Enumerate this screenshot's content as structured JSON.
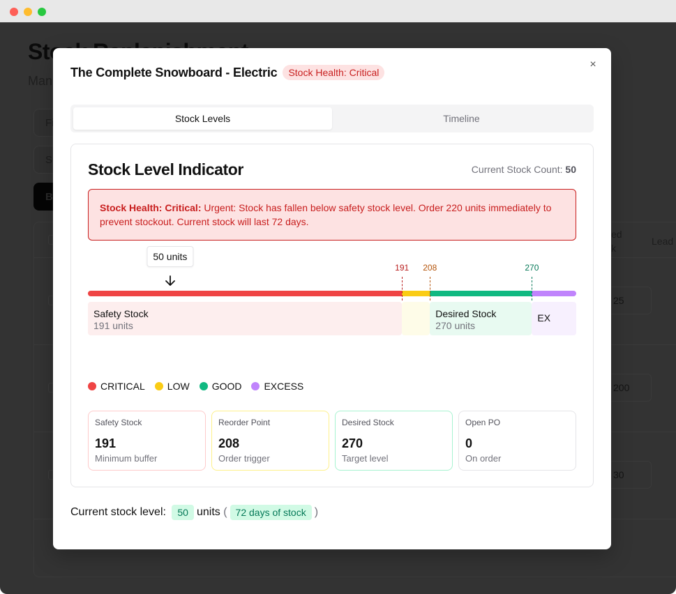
{
  "window": {
    "traffic_lights": [
      "close",
      "minimize",
      "maximize"
    ]
  },
  "background_page": {
    "title": "Stock Replenishment",
    "subtitle": "Man",
    "buttons": [
      "Fi",
      "Su",
      "Bu"
    ],
    "table_headers": [
      "ed\nk",
      "Lead"
    ],
    "lead_values": [
      "25",
      "200",
      "30"
    ]
  },
  "modal": {
    "title": "The Complete Snowboard - Electric",
    "health_badge": "Stock Health: Critical",
    "close_icon": "×",
    "tabs": [
      {
        "label": "Stock Levels",
        "active": true
      },
      {
        "label": "Timeline",
        "active": false
      }
    ],
    "card": {
      "title": "Stock Level Indicator",
      "stock_count_label": "Current Stock Count:",
      "stock_count_value": "50",
      "alert": {
        "prefix": "Stock Health: Critical:",
        "message": " Urgent: Stock has fallen below safety stock level. Order 220 units immediately to prevent stockout. Current stock will last 72 days."
      },
      "indicator": {
        "current_units": 50,
        "current_label": "50 units",
        "scale_max": 297,
        "thresholds": [
          {
            "value": 191,
            "label": "191",
            "color": "#b91c1c"
          },
          {
            "value": 208,
            "label": "208",
            "color": "#b45309"
          },
          {
            "value": 270,
            "label": "270",
            "color": "#047857"
          }
        ],
        "segments": [
          {
            "name": "critical",
            "from": 0,
            "to": 191,
            "color": "#ef4444"
          },
          {
            "name": "low",
            "from": 191,
            "to": 208,
            "color": "#facc15"
          },
          {
            "name": "good",
            "from": 208,
            "to": 270,
            "color": "#10b981"
          },
          {
            "name": "excess",
            "from": 270,
            "to": 297,
            "color": "#c084fc"
          }
        ],
        "zones": [
          {
            "name": "Safety Stock",
            "units": "191 units",
            "from": 0,
            "to": 191,
            "bg": "#fdeeee"
          },
          {
            "name": "",
            "units": "",
            "from": 191,
            "to": 208,
            "bg": "#fefce8"
          },
          {
            "name": "Desired Stock",
            "units": "270 units",
            "from": 208,
            "to": 270,
            "bg": "#e8faf1"
          },
          {
            "name": "EX",
            "units": "",
            "from": 270,
            "to": 297,
            "bg": "#f7f0fe"
          }
        ]
      },
      "legend": [
        {
          "label": "CRITICAL",
          "color": "#ef4444"
        },
        {
          "label": "LOW",
          "color": "#facc15"
        },
        {
          "label": "GOOD",
          "color": "#10b981"
        },
        {
          "label": "EXCESS",
          "color": "#c084fc"
        }
      ],
      "metrics": [
        {
          "label": "Safety Stock",
          "value": "191",
          "desc": "Minimum buffer",
          "border": "#fecaca"
        },
        {
          "label": "Reorder Point",
          "value": "208",
          "desc": "Order trigger",
          "border": "#fef08a"
        },
        {
          "label": "Desired Stock",
          "value": "270",
          "desc": "Target level",
          "border": "#a7f3d0"
        },
        {
          "label": "Open PO",
          "value": "0",
          "desc": "On order",
          "border": "#e4e4e7"
        }
      ]
    },
    "summary": {
      "label": "Current stock level:",
      "units_value": "50",
      "units_text": "units",
      "open_paren": "(",
      "days_text": "72 days of stock",
      "close_paren": ")"
    }
  }
}
